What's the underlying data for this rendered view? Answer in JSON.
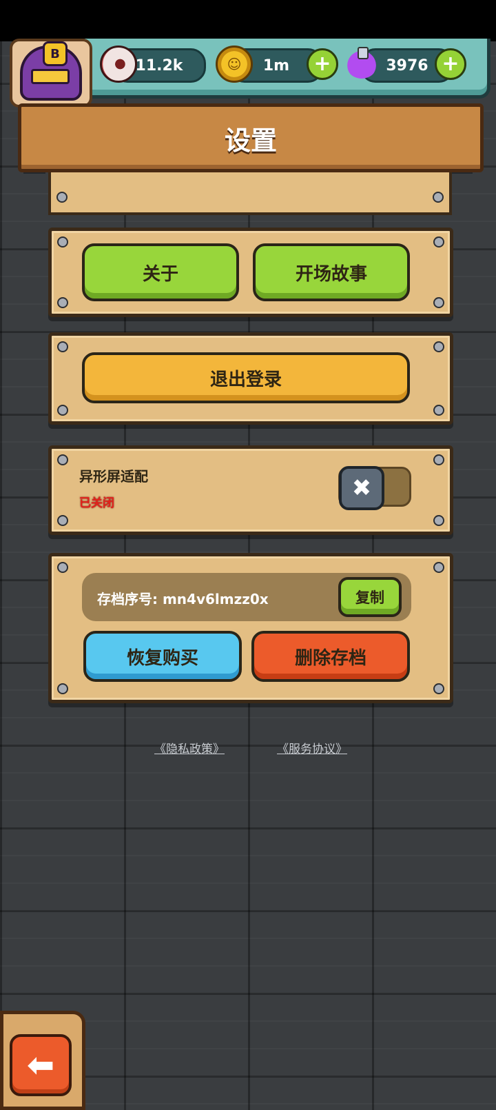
{
  "header": {
    "resources": [
      {
        "name": "eye",
        "value": "11.2k"
      },
      {
        "name": "coin",
        "value": "1m"
      },
      {
        "name": "potion",
        "value": "3976"
      }
    ],
    "avatar_badge": "B",
    "plus_symbol": "+"
  },
  "page": {
    "title": "设置"
  },
  "buttons": {
    "about": "关于",
    "opening_story": "开场故事",
    "logout": "退出登录",
    "copy": "复制",
    "restore_purchase": "恢复购买",
    "delete_save": "删除存档"
  },
  "notch_adaptation": {
    "label": "异形屏适配",
    "status": "已关闭",
    "toggle_symbol": "✖",
    "enabled": false
  },
  "save": {
    "label": "存档序号: mn4v6lmzz0x"
  },
  "links": {
    "privacy": "《隐私政策》",
    "service": "《服务协议》"
  },
  "back_symbol": "⬅",
  "colors": {
    "green_button": "#98d63b",
    "orange_button": "#f3b63b",
    "blue_button": "#58c8ef",
    "red_button": "#ec5b2b",
    "status_off": "#e2211b",
    "panel": "#e3be83"
  },
  "icons": [
    "eye-icon",
    "coin-icon",
    "potion-icon",
    "plus-icon",
    "close-icon",
    "arrow-left-icon"
  ]
}
